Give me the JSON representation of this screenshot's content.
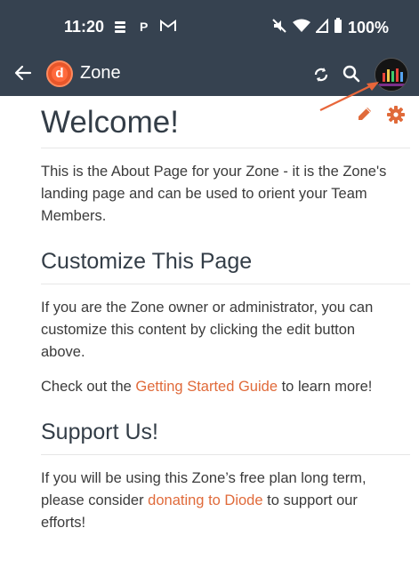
{
  "status": {
    "time": "11:20",
    "notif_p": "P",
    "battery": "100%"
  },
  "appbar": {
    "title": "Zone",
    "logo_letter": "d"
  },
  "page": {
    "heading": "Welcome!",
    "intro": "This is the About Page for your Zone - it is the Zone's landing page and can be used to orient your Team Members.",
    "section1_title": "Customize This Page",
    "section1_text": "If you are the Zone owner or administrator, you can customize this content by clicking the edit button above.",
    "check_prefix": "Check out the ",
    "check_link": "Getting Started Guide",
    "check_suffix": " to learn more!",
    "section2_title": "Support Us!",
    "support_prefix": "If you will be using this Zone’s free plan long term, please consider ",
    "support_link": "donating to Diode",
    "support_suffix": " to support our efforts!"
  },
  "colors": {
    "bar": "#364250",
    "accent": "#e06a3a"
  },
  "icons": [
    "back-arrow-icon",
    "sync-icon",
    "search-icon",
    "edit-icon",
    "settings-icon"
  ]
}
